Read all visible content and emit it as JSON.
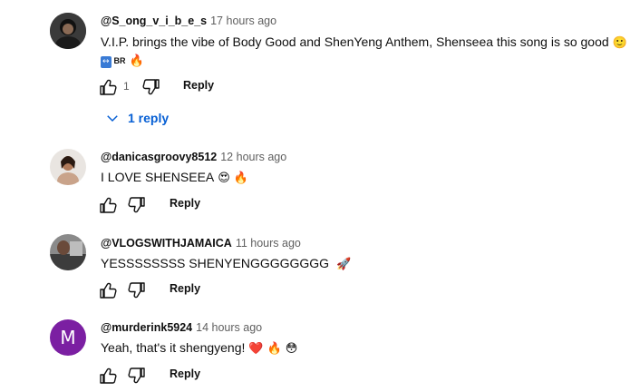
{
  "comments": [
    {
      "handle": "@S_ong_v_i_b_e_s",
      "time": "17 hours ago",
      "text": "V.I.P. brings the vibe of Body Good and ShenYeng Anthem, Shenseea this song is so good",
      "text_emoji": "🙂",
      "line2_badge": "↔",
      "line2_text": "BR",
      "line2_emoji": "🔥",
      "likes": "1",
      "reply_label": "Reply",
      "replies_label": "1 reply",
      "avatar_icon": "profile-photo"
    },
    {
      "handle": "@danicasgroovy8512",
      "time": "12 hours ago",
      "text": "I LOVE SHENSEEA",
      "emojis": [
        "😍",
        "🔥"
      ],
      "reply_label": "Reply",
      "avatar_icon": "profile-photo"
    },
    {
      "handle": "@VLOGSWITHJAMAICA",
      "time": "11 hours ago",
      "text": "YESSSSSSSS SHENYENGGGGGGGG",
      "emojis": [
        "🚀"
      ],
      "reply_label": "Reply",
      "avatar_icon": "profile-photo"
    },
    {
      "handle": "@murderink5924",
      "time": "14 hours ago",
      "text": "Yeah, that's it shengyeng!",
      "emojis": [
        "❤️",
        "🔥",
        "😳"
      ],
      "reply_label": "Reply",
      "avatar_letter": "M",
      "avatar_color": "#7b1fa2"
    }
  ],
  "colors": {
    "link": "#065fd4",
    "muted": "#606060",
    "text": "#0f0f0f"
  }
}
